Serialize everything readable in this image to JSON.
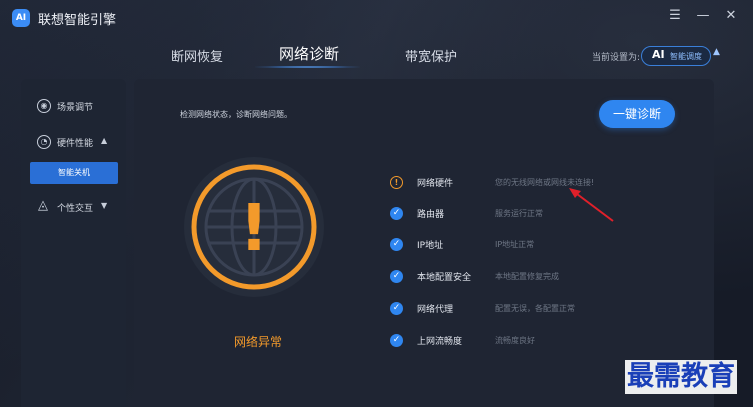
{
  "window": {
    "title": "联想智能引擎",
    "logo_text": "AI",
    "settings_glyph": "☰",
    "minimize_glyph": "—",
    "close_glyph": "✕"
  },
  "tabs": [
    {
      "label": "断网恢复",
      "active": false
    },
    {
      "label": "网络诊断",
      "active": true
    },
    {
      "label": "带宽保护",
      "active": false
    }
  ],
  "mode": {
    "label": "当前设置为:",
    "badge": "AI",
    "value": "智能调度",
    "caret": "▲"
  },
  "sidebar": {
    "items": [
      {
        "label": "场景调节",
        "icon": "target-icon",
        "glyph": "◉"
      },
      {
        "label": "硬件性能",
        "icon": "gauge-icon",
        "glyph": "◔",
        "caret": "▲"
      },
      {
        "label": "个性交互",
        "icon": "triangle-nodes-icon",
        "glyph": "◬",
        "caret": "▼"
      }
    ],
    "sub_item": "智能关机"
  },
  "main": {
    "description": "检测网络状态，诊断网络问题。",
    "diagnose_button": "一键诊断",
    "status_text": "网络异常",
    "status_icon": "!",
    "checks": [
      {
        "name": "网络硬件",
        "status": "您的无线网络或网线未连接!",
        "state": "warning",
        "glyph": "!"
      },
      {
        "name": "路由器",
        "status": "服务运行正常",
        "state": "ok",
        "glyph": "✓"
      },
      {
        "name": "IP地址",
        "status": "IP地址正常",
        "state": "ok",
        "glyph": "✓"
      },
      {
        "name": "本地配置安全",
        "status": "本地配置修复完成",
        "state": "ok",
        "glyph": "✓"
      },
      {
        "name": "网络代理",
        "status": "配置无误，各配置正常",
        "state": "ok",
        "glyph": "✓"
      },
      {
        "name": "上网流畅度",
        "status": "流畅度良好",
        "state": "ok",
        "glyph": "✓"
      }
    ]
  },
  "watermark": "最需教育",
  "colors": {
    "accent": "#2f86f0",
    "warning": "#f39a2b",
    "annotation_arrow": "#e0202a"
  }
}
